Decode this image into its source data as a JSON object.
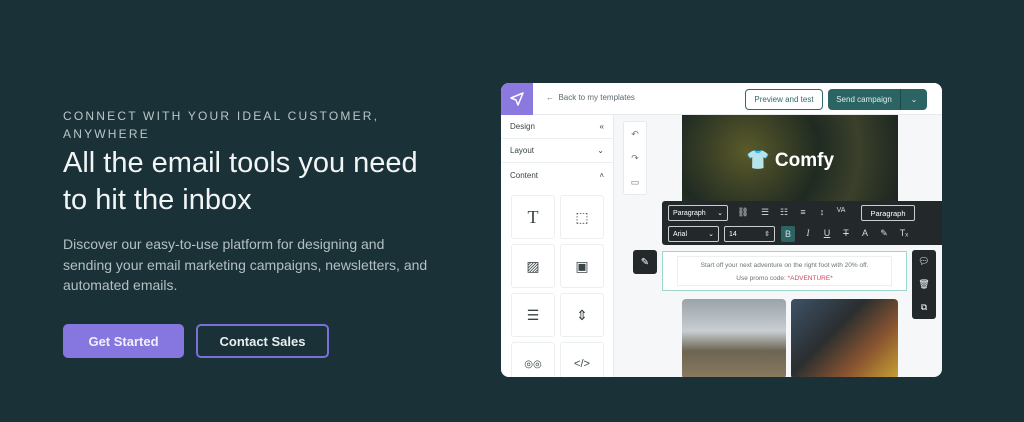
{
  "hero": {
    "eyebrow": "CONNECT WITH YOUR IDEAL CUSTOMER, ANYWHERE",
    "title": "All the email tools you need to hit the inbox",
    "description": "Discover our easy-to-use platform for designing and sending your email marketing campaigns, newsletters, and automated emails.",
    "primary_button": "Get Started",
    "secondary_button": "Contact Sales"
  },
  "editor": {
    "back_link": "Back to my templates",
    "preview_button": "Preview and test",
    "send_button": "Send campaign",
    "sidebar": [
      {
        "label": "Design",
        "icon": "collapse-icon"
      },
      {
        "label": "Layout",
        "icon": "chevron-down-icon"
      },
      {
        "label": "Content",
        "icon": "chevron-up-icon"
      }
    ],
    "brand": "Comfy",
    "toolbar": {
      "block_type": "Paragraph",
      "style_button": "Paragraph",
      "font": "Arial",
      "size": "14"
    },
    "text_line1": "Start off your next adventure on the right foot with 20% off.",
    "text_line2": "Use promo code: ",
    "promo_code": "*ADVENTURE*"
  },
  "colors": {
    "background": "#1b3138",
    "accent": "#8677e0",
    "teal": "#2b6462",
    "promo": "#d2455a"
  }
}
